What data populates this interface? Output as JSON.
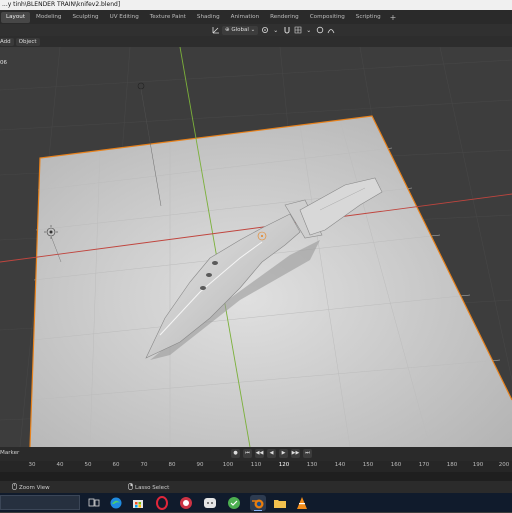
{
  "window": {
    "title": "...y tinh\\BLENDER TRAIN\\knifev2.blend]"
  },
  "workspaces": {
    "tabs": [
      "Layout",
      "Modeling",
      "Sculpting",
      "UV Editing",
      "Texture Paint",
      "Shading",
      "Animation",
      "Rendering",
      "Compositing",
      "Scripting"
    ],
    "active": "Layout",
    "add_label": "+"
  },
  "toolbar": {
    "orientation_label": "Global",
    "orientation_icon": "globe-icon",
    "snap_icon": "magnet-icon",
    "proportional_icon": "circle-icon"
  },
  "viewport_header": {
    "add_label": "Add",
    "object_label": "Object"
  },
  "viewport": {
    "frame_text": "06",
    "floor_color": "#c8c8c8",
    "selection_outline_color": "#e8821c",
    "x_axis_color": "#c0453e",
    "y_axis_color": "#7bb03a"
  },
  "timeline": {
    "marker_label": "Marker",
    "ruler_ticks": [
      "30",
      "40",
      "50",
      "60",
      "70",
      "80",
      "90",
      "100",
      "110",
      "120",
      "130",
      "140",
      "150",
      "160",
      "170",
      "180",
      "190",
      "200",
      "210"
    ],
    "current_frame": "120"
  },
  "statusbar": {
    "zoom_view_label": "Zoom View",
    "lasso_select_label": "Lasso Select"
  },
  "taskbar": {
    "apps": [
      "task-view-icon",
      "edge-icon",
      "store-icon",
      "opera-icon",
      "discord-icon",
      "wechat-icon",
      "blender-icon",
      "folder-icon",
      "vlc-icon"
    ],
    "active_app": "blender-icon"
  }
}
